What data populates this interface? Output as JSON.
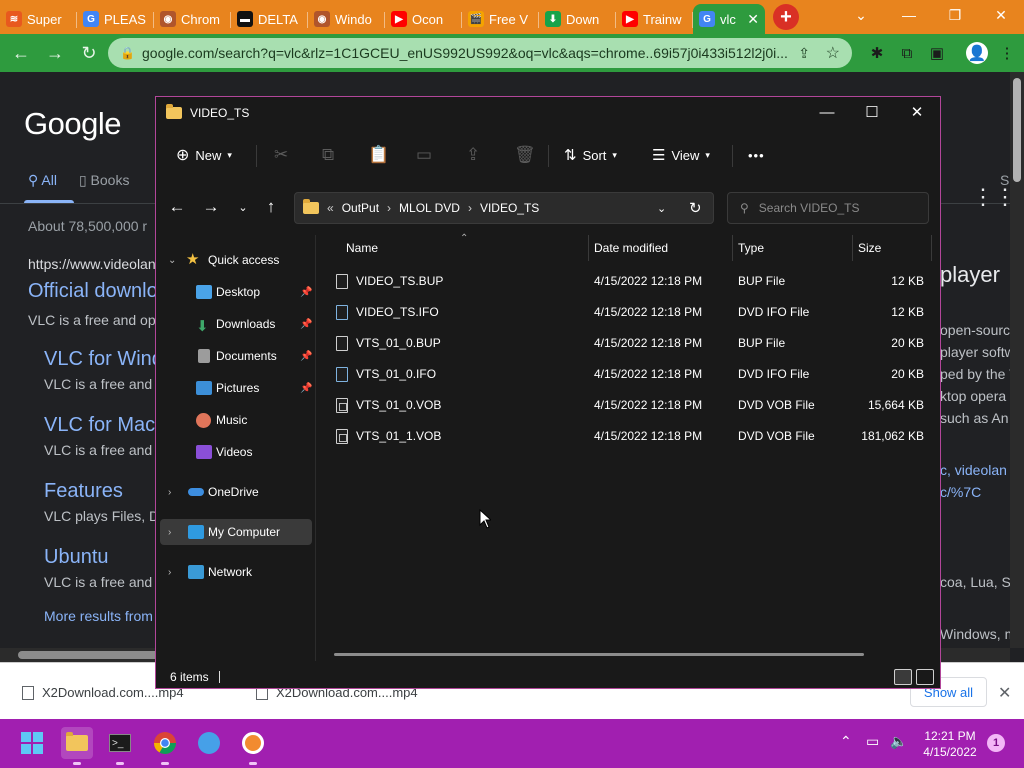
{
  "browser": {
    "tabs": [
      {
        "label": "Super",
        "color": "#e8591e",
        "glyph": "≋"
      },
      {
        "label": "PLEAS",
        "color": "#4285f4",
        "glyph": "G"
      },
      {
        "label": "Chrom",
        "color": "#b0552b",
        "glyph": "◉"
      },
      {
        "label": "DELTA",
        "color": "#111111",
        "glyph": "▬"
      },
      {
        "label": "Windo",
        "color": "#b0552b",
        "glyph": "◉"
      },
      {
        "label": "Ocon",
        "color": "#ff0000",
        "glyph": "▶"
      },
      {
        "label": "Free V",
        "color": "#f4a300",
        "glyph": "🎬"
      },
      {
        "label": "Down",
        "color": "#16a34a",
        "glyph": "⬇"
      },
      {
        "label": "Trainw",
        "color": "#ff0000",
        "glyph": "▶"
      },
      {
        "label": "vlc",
        "color": "#4285f4",
        "glyph": "G"
      }
    ],
    "new_tab": "+",
    "url": "google.com/search?q=vlc&rlz=1C1GCEU_enUS992US992&oq=vlc&aqs=chrome..69i57j0i433i512l2j0i..."
  },
  "google": {
    "logo": "Google",
    "tab_all": "All",
    "tab_books": "Books",
    "tab_s": "S",
    "about": "About 78,500,000 r",
    "result_url": "https://www.videolan",
    "result_title": "Official downlo",
    "result_snip": "VLC is a free and op",
    "sub1_title": "VLC for Wind",
    "sub1_snip": "VLC is a free and",
    "sub2_title": "VLC for Mac",
    "sub2_snip": "VLC is a free and",
    "sub3_title": "Features",
    "sub3_snip": "VLC plays Files, D",
    "sub4_title": "Ubuntu",
    "sub4_snip": "VLC is a free and",
    "more": "More results from",
    "right_title": "player",
    "right_lines": [
      "open-sourc",
      "player softw",
      "ped by the V",
      "ktop opera",
      "such as An",
      "c, videolan",
      "c/%7C",
      "coa, Lua, S",
      "Windows, m"
    ]
  },
  "downloads": {
    "item1": "X2Download.com....mp4",
    "item2": "X2Download.com....mp4",
    "show_all": "Show all"
  },
  "explorer": {
    "title": "VIDEO_TS",
    "new_label": "New",
    "sort_label": "Sort",
    "view_label": "View",
    "more_label": "•••",
    "breadcrumb": [
      "OutPut",
      "MLOL DVD",
      "VIDEO_TS"
    ],
    "crumb_prefix": "«",
    "search_placeholder": "Search VIDEO_TS",
    "nav": {
      "quick_access": "Quick access",
      "desktop": "Desktop",
      "downloads": "Downloads",
      "documents": "Documents",
      "pictures": "Pictures",
      "music": "Music",
      "videos": "Videos",
      "onedrive": "OneDrive",
      "my_computer": "My Computer",
      "network": "Network"
    },
    "columns": {
      "name": "Name",
      "modified": "Date modified",
      "type": "Type",
      "size": "Size"
    },
    "files": [
      {
        "name": "VIDEO_TS.BUP",
        "modified": "4/15/2022 12:18 PM",
        "type": "BUP File",
        "size": "12 KB",
        "kind": "bup"
      },
      {
        "name": "VIDEO_TS.IFO",
        "modified": "4/15/2022 12:18 PM",
        "type": "DVD IFO File",
        "size": "12 KB",
        "kind": "ifo"
      },
      {
        "name": "VTS_01_0.BUP",
        "modified": "4/15/2022 12:18 PM",
        "type": "BUP File",
        "size": "20 KB",
        "kind": "bup"
      },
      {
        "name": "VTS_01_0.IFO",
        "modified": "4/15/2022 12:18 PM",
        "type": "DVD IFO File",
        "size": "20 KB",
        "kind": "ifo"
      },
      {
        "name": "VTS_01_0.VOB",
        "modified": "4/15/2022 12:18 PM",
        "type": "DVD VOB File",
        "size": "15,664 KB",
        "kind": "vob"
      },
      {
        "name": "VTS_01_1.VOB",
        "modified": "4/15/2022 12:18 PM",
        "type": "DVD VOB File",
        "size": "181,062 KB",
        "kind": "vob"
      }
    ],
    "status": "6 items"
  },
  "taskbar": {
    "time": "12:21 PM",
    "date": "4/15/2022",
    "notifications": "1"
  },
  "colors": {
    "tabbar": "#e8841e",
    "chrome_toolbar": "#2e9b3e",
    "taskbar": "#a11fb0",
    "explorer_bg": "#191919",
    "explorer_border": "#b2469a",
    "link": "#8ab4f8"
  }
}
